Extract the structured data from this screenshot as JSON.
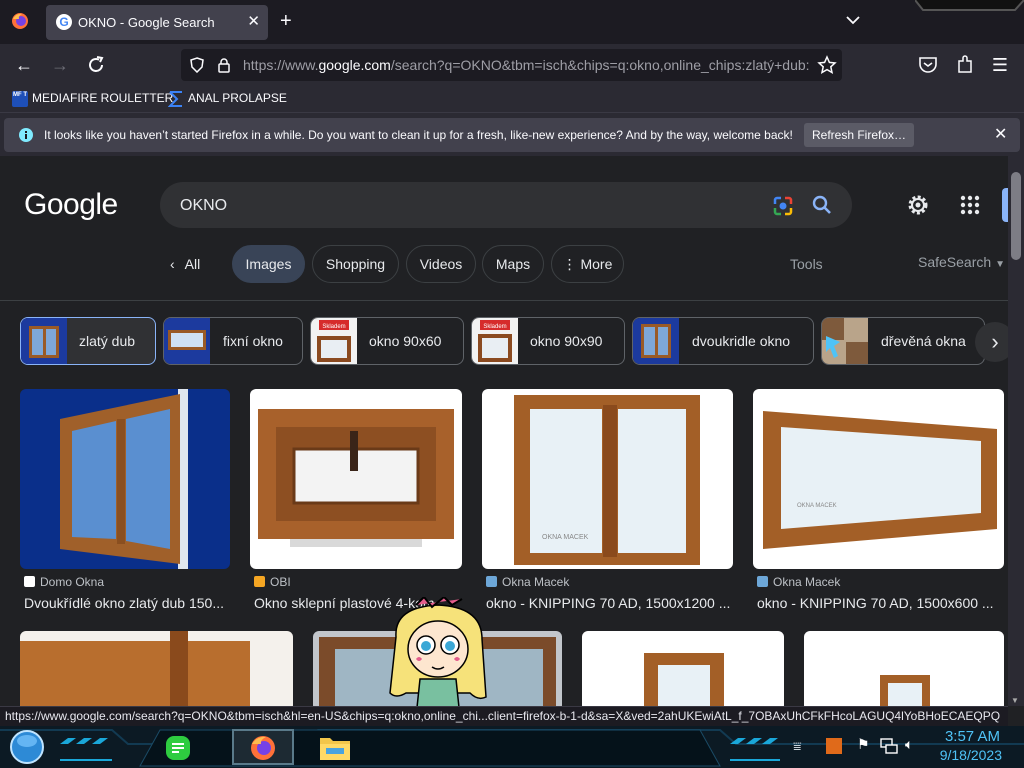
{
  "browser": {
    "tab_title": "OKNO - Google Search",
    "tab_favicon_letter": "G",
    "url_prefix": "https://www.",
    "url_domain": "google.com",
    "url_rest": "/search?q=OKNO&tbm=isch&chips=q:okno,online_chips:zlatý+dub:",
    "bookmarks": [
      {
        "label": "MEDIAFIRE ROULETTER",
        "badge": "MF T"
      },
      {
        "label": "ANAL PROLAPSE"
      }
    ],
    "notification": {
      "message": "It looks like you haven’t started Firefox in a while. Do you want to clean it up for a fresh, like-new experience? And by the way, welcome back!",
      "button": "Refresh Firefox…"
    }
  },
  "google": {
    "logo": "Google",
    "query": "OKNO",
    "nav": {
      "all": "All",
      "tabs": [
        "Images",
        "Shopping",
        "Videos",
        "Maps",
        "More"
      ],
      "active": "Images",
      "tools": "Tools",
      "safesearch": "SafeSearch"
    },
    "chips": [
      {
        "label": "zlatý dub",
        "selected": true
      },
      {
        "label": "fixní okno"
      },
      {
        "label": "okno 90x60",
        "thumb_text": "Skladem"
      },
      {
        "label": "okno 90x90",
        "thumb_text": "Skladem"
      },
      {
        "label": "dvoukridle okno"
      },
      {
        "label": "dřevěná okna"
      }
    ],
    "results": [
      {
        "source": "Domo Okna",
        "title": "Dvoukřídlé okno zlatý dub 150..."
      },
      {
        "source": "OBI",
        "title": "Okno sklepní plastové 4-kom..."
      },
      {
        "source": "Okna Macek",
        "title": "okno - KNIPPING 70 AD, 1500x1200 ..."
      },
      {
        "source": "Okna Macek",
        "title": "okno - KNIPPING 70 AD, 1500x600 ..."
      }
    ],
    "watermark": "OKNA MACEK"
  },
  "status_url": "https://www.google.com/search?q=OKNO&tbm=isch&hl=en-US&chips=q:okno,online_chi...client=firefox-b-1-d&sa=X&ved=2ahUKEwiAtL_f_7OBAxUhCFkFHcoLAGUQ4lYoBHoECAEQPQ",
  "taskbar": {
    "time": "3:57 AM",
    "date": "9/18/2023"
  },
  "colors": {
    "accent": "#8ab4f8",
    "tab_bg": "#42414d",
    "clock": "#4fc3f7"
  }
}
